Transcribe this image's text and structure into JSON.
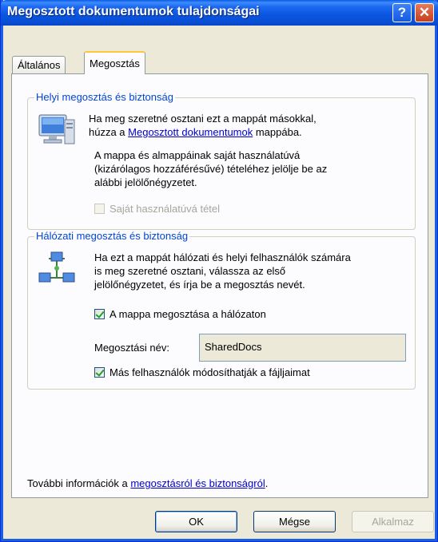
{
  "window": {
    "title": "Megosztott dokumentumok tulajdonságai",
    "help_glyph": "?",
    "close_glyph": "✕"
  },
  "tabs": [
    {
      "label": "Általános",
      "active": false
    },
    {
      "label": "Megosztás",
      "active": true
    }
  ],
  "local_sharing": {
    "title": "Helyi megosztás és biztonság",
    "icon": "computer-icon",
    "text1_a": "Ha meg szeretné osztani ezt a mappát másokkal,",
    "text1_b_pre": "húzza a ",
    "text1_b_link": "Megosztott dokumentumok",
    "text1_b_post": " mappába.",
    "text2_l1": "A mappa és almappáinak saját használatúvá",
    "text2_l2": "(kizárólagos hozzáférésűvé) tételéhez jelölje be az",
    "text2_l3": "alábbi jelölőnégyzetet.",
    "private_checkbox_label": "Saját használatúvá tétel",
    "private_checked": false
  },
  "network_sharing": {
    "title": "Hálózati megosztás és biztonság",
    "icon": "network-icon",
    "text_l1": "Ha ezt a mappát hálózati és helyi felhasználók számára",
    "text_l2": "is meg szeretné osztani, válassza az első",
    "text_l3": "jelölőnégyzetet, és írja be a megosztás nevét.",
    "share_checkbox_label": "A mappa megosztása a hálózaton",
    "share_checked": true,
    "share_name_label": "Megosztási név:",
    "share_name_value": "SharedDocs",
    "modify_checkbox_label": "Más felhasználók módosíthatják a fájljaimat",
    "modify_checked": true
  },
  "footer": {
    "info_pre": "További információk a ",
    "info_link": "megosztásról és biztonságról",
    "info_post": "."
  },
  "buttons": {
    "ok": "OK",
    "cancel": "Mégse",
    "apply": "Alkalmaz"
  }
}
